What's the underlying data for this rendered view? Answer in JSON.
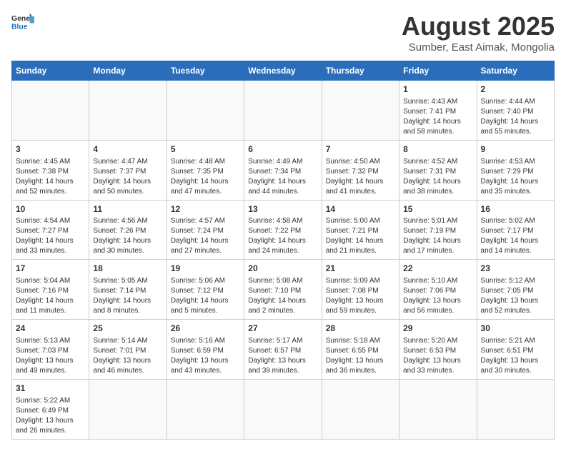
{
  "header": {
    "logo_general": "General",
    "logo_blue": "Blue",
    "title": "August 2025",
    "subtitle": "Sumber, East Aimak, Mongolia"
  },
  "weekdays": [
    "Sunday",
    "Monday",
    "Tuesday",
    "Wednesday",
    "Thursday",
    "Friday",
    "Saturday"
  ],
  "weeks": [
    [
      {
        "day": "",
        "info": ""
      },
      {
        "day": "",
        "info": ""
      },
      {
        "day": "",
        "info": ""
      },
      {
        "day": "",
        "info": ""
      },
      {
        "day": "",
        "info": ""
      },
      {
        "day": "1",
        "info": "Sunrise: 4:43 AM\nSunset: 7:41 PM\nDaylight: 14 hours and 58 minutes."
      },
      {
        "day": "2",
        "info": "Sunrise: 4:44 AM\nSunset: 7:40 PM\nDaylight: 14 hours and 55 minutes."
      }
    ],
    [
      {
        "day": "3",
        "info": "Sunrise: 4:45 AM\nSunset: 7:38 PM\nDaylight: 14 hours and 52 minutes."
      },
      {
        "day": "4",
        "info": "Sunrise: 4:47 AM\nSunset: 7:37 PM\nDaylight: 14 hours and 50 minutes."
      },
      {
        "day": "5",
        "info": "Sunrise: 4:48 AM\nSunset: 7:35 PM\nDaylight: 14 hours and 47 minutes."
      },
      {
        "day": "6",
        "info": "Sunrise: 4:49 AM\nSunset: 7:34 PM\nDaylight: 14 hours and 44 minutes."
      },
      {
        "day": "7",
        "info": "Sunrise: 4:50 AM\nSunset: 7:32 PM\nDaylight: 14 hours and 41 minutes."
      },
      {
        "day": "8",
        "info": "Sunrise: 4:52 AM\nSunset: 7:31 PM\nDaylight: 14 hours and 38 minutes."
      },
      {
        "day": "9",
        "info": "Sunrise: 4:53 AM\nSunset: 7:29 PM\nDaylight: 14 hours and 35 minutes."
      }
    ],
    [
      {
        "day": "10",
        "info": "Sunrise: 4:54 AM\nSunset: 7:27 PM\nDaylight: 14 hours and 33 minutes."
      },
      {
        "day": "11",
        "info": "Sunrise: 4:56 AM\nSunset: 7:26 PM\nDaylight: 14 hours and 30 minutes."
      },
      {
        "day": "12",
        "info": "Sunrise: 4:57 AM\nSunset: 7:24 PM\nDaylight: 14 hours and 27 minutes."
      },
      {
        "day": "13",
        "info": "Sunrise: 4:58 AM\nSunset: 7:22 PM\nDaylight: 14 hours and 24 minutes."
      },
      {
        "day": "14",
        "info": "Sunrise: 5:00 AM\nSunset: 7:21 PM\nDaylight: 14 hours and 21 minutes."
      },
      {
        "day": "15",
        "info": "Sunrise: 5:01 AM\nSunset: 7:19 PM\nDaylight: 14 hours and 17 minutes."
      },
      {
        "day": "16",
        "info": "Sunrise: 5:02 AM\nSunset: 7:17 PM\nDaylight: 14 hours and 14 minutes."
      }
    ],
    [
      {
        "day": "17",
        "info": "Sunrise: 5:04 AM\nSunset: 7:16 PM\nDaylight: 14 hours and 11 minutes."
      },
      {
        "day": "18",
        "info": "Sunrise: 5:05 AM\nSunset: 7:14 PM\nDaylight: 14 hours and 8 minutes."
      },
      {
        "day": "19",
        "info": "Sunrise: 5:06 AM\nSunset: 7:12 PM\nDaylight: 14 hours and 5 minutes."
      },
      {
        "day": "20",
        "info": "Sunrise: 5:08 AM\nSunset: 7:10 PM\nDaylight: 14 hours and 2 minutes."
      },
      {
        "day": "21",
        "info": "Sunrise: 5:09 AM\nSunset: 7:08 PM\nDaylight: 13 hours and 59 minutes."
      },
      {
        "day": "22",
        "info": "Sunrise: 5:10 AM\nSunset: 7:06 PM\nDaylight: 13 hours and 56 minutes."
      },
      {
        "day": "23",
        "info": "Sunrise: 5:12 AM\nSunset: 7:05 PM\nDaylight: 13 hours and 52 minutes."
      }
    ],
    [
      {
        "day": "24",
        "info": "Sunrise: 5:13 AM\nSunset: 7:03 PM\nDaylight: 13 hours and 49 minutes."
      },
      {
        "day": "25",
        "info": "Sunrise: 5:14 AM\nSunset: 7:01 PM\nDaylight: 13 hours and 46 minutes."
      },
      {
        "day": "26",
        "info": "Sunrise: 5:16 AM\nSunset: 6:59 PM\nDaylight: 13 hours and 43 minutes."
      },
      {
        "day": "27",
        "info": "Sunrise: 5:17 AM\nSunset: 6:57 PM\nDaylight: 13 hours and 39 minutes."
      },
      {
        "day": "28",
        "info": "Sunrise: 5:18 AM\nSunset: 6:55 PM\nDaylight: 13 hours and 36 minutes."
      },
      {
        "day": "29",
        "info": "Sunrise: 5:20 AM\nSunset: 6:53 PM\nDaylight: 13 hours and 33 minutes."
      },
      {
        "day": "30",
        "info": "Sunrise: 5:21 AM\nSunset: 6:51 PM\nDaylight: 13 hours and 30 minutes."
      }
    ],
    [
      {
        "day": "31",
        "info": "Sunrise: 5:22 AM\nSunset: 6:49 PM\nDaylight: 13 hours and 26 minutes."
      },
      {
        "day": "",
        "info": ""
      },
      {
        "day": "",
        "info": ""
      },
      {
        "day": "",
        "info": ""
      },
      {
        "day": "",
        "info": ""
      },
      {
        "day": "",
        "info": ""
      },
      {
        "day": "",
        "info": ""
      }
    ]
  ]
}
